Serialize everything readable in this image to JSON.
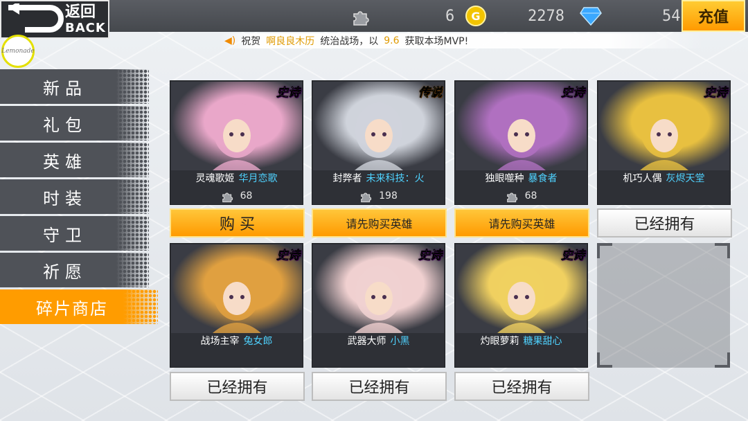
{
  "header": {
    "back_cn": "返回",
    "back_en": "BACK",
    "shards_value": "6",
    "gold_value": "2278",
    "diamond_value": "54",
    "charge_label": "充值"
  },
  "notice": {
    "prefix": "祝贺",
    "player": "啊良良木历",
    "middle": "统治战场，以",
    "score": "9.6",
    "suffix": "获取本场MVP!"
  },
  "logo_text": "Lemonade",
  "sidebar": {
    "items": [
      {
        "label": "新品"
      },
      {
        "label": "礼包"
      },
      {
        "label": "英雄"
      },
      {
        "label": "时装"
      },
      {
        "label": "守卫"
      },
      {
        "label": "祈愿"
      },
      {
        "label": "碎片商店"
      }
    ],
    "active_index": 6
  },
  "cards": [
    {
      "rarity": "史诗",
      "hero": "灵魂歌姬",
      "skin": "华月恋歌",
      "shards": "68",
      "action": "购 买",
      "action_type": "buy",
      "theme": "#e9a7c9"
    },
    {
      "rarity": "传说",
      "hero": "封弊者",
      "skin": "未来科技：火",
      "shards": "198",
      "action": "请先购买英雄",
      "action_type": "need",
      "theme": "#cfd3db"
    },
    {
      "rarity": "史诗",
      "hero": "独眼噬种",
      "skin": "暴食者",
      "shards": "68",
      "action": "请先购买英雄",
      "action_type": "need",
      "theme": "#b070c0"
    },
    {
      "rarity": "史诗",
      "hero": "机巧人偶",
      "skin": "灰烬天堂",
      "shards": "",
      "action": "已经拥有",
      "action_type": "owned",
      "theme": "#e8c040"
    },
    {
      "rarity": "史诗",
      "hero": "战场主宰",
      "skin": "兔女郎",
      "shards": "",
      "action": "已经拥有",
      "action_type": "owned",
      "theme": "#e0a040"
    },
    {
      "rarity": "史诗",
      "hero": "武器大师",
      "skin": "小黑",
      "shards": "",
      "action": "已经拥有",
      "action_type": "owned",
      "theme": "#f0d0d0"
    },
    {
      "rarity": "史诗",
      "hero": "灼眼萝莉",
      "skin": "糖果甜心",
      "shards": "",
      "action": "已经拥有",
      "action_type": "owned",
      "theme": "#f0d060"
    }
  ]
}
